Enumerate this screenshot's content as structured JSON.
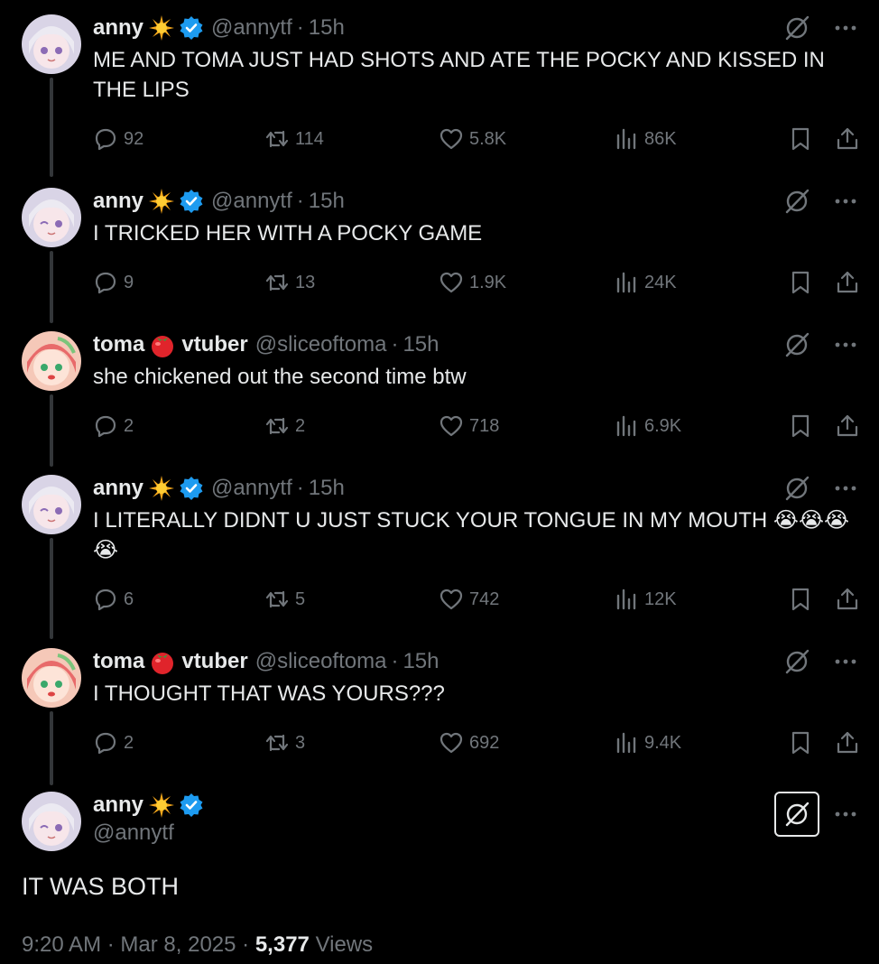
{
  "tweets": [
    {
      "name": "anny",
      "handle": "@annytf",
      "time": "15h",
      "text": "ME AND TOMA JUST HAD SHOTS AND ATE THE POCKY AND KISSED IN THE LIPS",
      "replies": "92",
      "retweets": "114",
      "likes": "5.8K",
      "views": "86K"
    },
    {
      "name": "anny",
      "handle": "@annytf",
      "time": "15h",
      "text": "I TRICKED HER WITH A POCKY GAME",
      "replies": "9",
      "retweets": "13",
      "likes": "1.9K",
      "views": "24K"
    },
    {
      "name": "toma",
      "name_suffix": "vtuber",
      "handle": "@sliceoftoma",
      "time": "15h",
      "text": "she chickened out the second time btw",
      "replies": "2",
      "retweets": "2",
      "likes": "718",
      "views": "6.9K"
    },
    {
      "name": "anny",
      "handle": "@annytf",
      "time": "15h",
      "text": "I LITERALLY DIDNT U JUST STUCK YOUR TONGUE IN MY MOUTH 😭😭😭😭",
      "replies": "6",
      "retweets": "5",
      "likes": "742",
      "views": "12K"
    },
    {
      "name": "toma",
      "name_suffix": "vtuber",
      "handle": "@sliceoftoma",
      "time": "15h",
      "text": "I THOUGHT THAT WAS YOURS???",
      "replies": "2",
      "retweets": "3",
      "likes": "692",
      "views": "9.4K"
    }
  ],
  "focal": {
    "name": "anny",
    "handle": "@annytf",
    "text": "IT WAS BOTH",
    "time": "9:20 AM",
    "date": "Mar 8, 2025",
    "views_count": "5,377",
    "views_label": "Views"
  },
  "separator": "·",
  "colors": {
    "background": "#000000",
    "text": "#e7e9ea",
    "muted": "#71767b",
    "verified": "#1d9bf0",
    "connector": "#333639"
  },
  "icons": [
    "sun-icon",
    "verified-badge-icon",
    "tomato-icon",
    "grok-icon",
    "more-icon",
    "reply-icon",
    "retweet-icon",
    "like-icon",
    "views-icon",
    "bookmark-icon",
    "share-icon"
  ]
}
